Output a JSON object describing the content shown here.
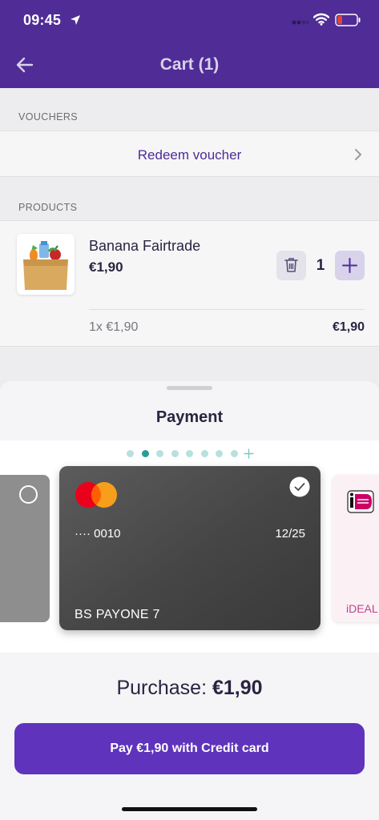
{
  "status_bar": {
    "time": "09:45",
    "icons": [
      "location-arrow-icon",
      "signal-icon",
      "wifi-icon",
      "battery-low-icon"
    ],
    "battery_color": "#e0443a"
  },
  "header": {
    "title": "Cart (1)",
    "back_icon": "arrow-left-icon",
    "background": "#4f2c96"
  },
  "vouchers": {
    "section_label": "VOUCHERS",
    "redeem_label": "Redeem voucher",
    "chevron_icon": "chevron-right-icon"
  },
  "products": {
    "section_label": "PRODUCTS",
    "items": [
      {
        "name": "Banana Fairtrade",
        "price": "€1,90",
        "quantity": "1",
        "unit_line": "1x €1,90",
        "line_total": "€1,90",
        "thumb_icon": "grocery-bag-icon"
      }
    ]
  },
  "payment": {
    "title": "Payment",
    "page_dots": 8,
    "active_dot": 1,
    "cards": [
      {
        "type": "other",
        "selected": false
      },
      {
        "type": "mastercard",
        "number": "···· 0010",
        "expiry": "12/25",
        "holder": "BS PAYONE 7",
        "selected": true
      },
      {
        "type": "ideal",
        "label": "iDEAL"
      }
    ],
    "purchase_label": "Purchase:",
    "purchase_amount": "€1,90",
    "pay_button": "Pay €1,90 with Credit card"
  },
  "colors": {
    "brand_purple": "#4f2c96",
    "button_purple": "#5f33bb",
    "teal_dot": "#2a9c98",
    "mastercard_red": "#eb001b",
    "mastercard_orange": "#f79e1b",
    "ideal_pink": "#cc0066"
  }
}
